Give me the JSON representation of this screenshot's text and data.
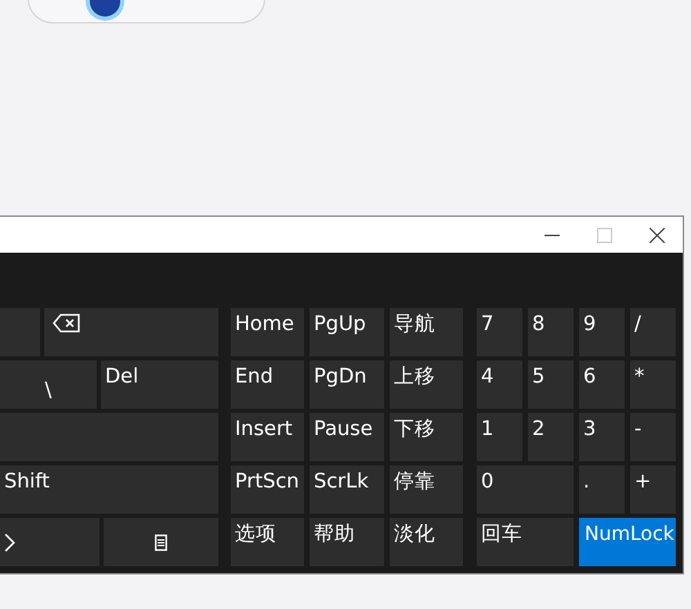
{
  "top_pill": {
    "icon": true
  },
  "window": {
    "controls": [
      {
        "kind": "minimize",
        "disabled": false
      },
      {
        "kind": "maximize",
        "disabled": true
      },
      {
        "kind": "close",
        "disabled": false
      }
    ]
  },
  "left_keys": [
    [
      {
        "kind": "blank"
      },
      {
        "kind": "backspace"
      }
    ],
    [
      {
        "kind": "center",
        "label": "\\"
      },
      {
        "kind": "text",
        "label": "Del"
      }
    ],
    [
      {
        "kind": "blank"
      }
    ],
    [
      {
        "kind": "text",
        "label": "Shift"
      }
    ],
    [
      {
        "kind": "chevron"
      },
      {
        "kind": "menu"
      }
    ]
  ],
  "nav_keys": [
    {
      "label": "Home"
    },
    {
      "label": "PgUp"
    },
    {
      "label": "导航"
    },
    {
      "label": "End"
    },
    {
      "label": "PgDn"
    },
    {
      "label": "上移"
    },
    {
      "label": "Insert"
    },
    {
      "label": "Pause"
    },
    {
      "label": "下移"
    },
    {
      "label": "PrtScn"
    },
    {
      "label": "ScrLk"
    },
    {
      "label": "停靠"
    },
    {
      "label": "选项"
    },
    {
      "label": "帮助"
    },
    {
      "label": "淡化"
    }
  ],
  "numpad_keys": [
    {
      "label": "7",
      "kind": "single",
      "on": false
    },
    {
      "label": "8",
      "kind": "single",
      "on": false
    },
    {
      "label": "9",
      "kind": "single",
      "on": false
    },
    {
      "label": "/",
      "kind": "single",
      "on": false
    },
    {
      "label": "4",
      "kind": "single",
      "on": false
    },
    {
      "label": "5",
      "kind": "single",
      "on": false
    },
    {
      "label": "6",
      "kind": "single",
      "on": false
    },
    {
      "label": "*",
      "kind": "single",
      "on": false
    },
    {
      "label": "1",
      "kind": "single",
      "on": false
    },
    {
      "label": "2",
      "kind": "single",
      "on": false
    },
    {
      "label": "3",
      "kind": "single",
      "on": false
    },
    {
      "label": "-",
      "kind": "single",
      "on": false
    },
    {
      "label": "0",
      "kind": "wide",
      "on": false
    },
    {
      "label": ".",
      "kind": "single",
      "on": false
    },
    {
      "label": "+",
      "kind": "single",
      "on": false
    },
    {
      "label": "回车",
      "kind": "wide",
      "on": false
    },
    {
      "label": "NumLock",
      "kind": "wide",
      "on": true
    }
  ]
}
